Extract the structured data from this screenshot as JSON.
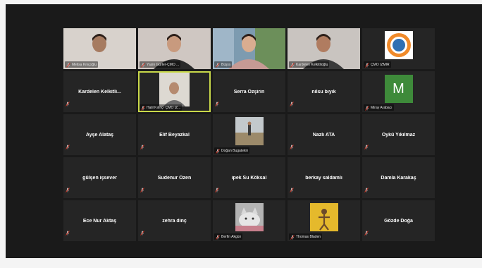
{
  "participants": [
    {
      "label": "Melisa Kılıçoğlu",
      "type": "video"
    },
    {
      "label": "Yasin Gürler-ÇMO ...",
      "type": "video"
    },
    {
      "label": "Büşra",
      "type": "video"
    },
    {
      "label": "Kardelen Kelkitlioğlu",
      "type": "video"
    },
    {
      "label": "ÇMO İZMİR",
      "type": "logo"
    },
    {
      "name": "Kardelen  Kelkitli...",
      "type": "name"
    },
    {
      "label": "Halil Kılınç- ÇMO İZ...",
      "type": "video",
      "active": true
    },
    {
      "name": "Serra Özşirin",
      "type": "name"
    },
    {
      "name": "nilsu bıyık",
      "type": "name"
    },
    {
      "label": "Miray Arabacı",
      "initial": "M",
      "type": "initial"
    },
    {
      "name": "Ayşe Alataş",
      "type": "name"
    },
    {
      "name": "Elif Beyazkal",
      "type": "name"
    },
    {
      "label": "Doğan Bugatekin",
      "type": "photo",
      "photo": "landscape"
    },
    {
      "name": "Nazlı ATA",
      "type": "name"
    },
    {
      "name": "Öykü Yıkılmaz",
      "type": "name"
    },
    {
      "name": "gülşen işsever",
      "type": "name"
    },
    {
      "name": "Sudenur Özen",
      "type": "name"
    },
    {
      "name": "ipek Su Köksal",
      "type": "name"
    },
    {
      "name": "berkay saldamlı",
      "type": "name"
    },
    {
      "name": "Damla Karakaş",
      "type": "name"
    },
    {
      "name": "Ece Nur Aktaş",
      "type": "name"
    },
    {
      "name": "zehra dinç",
      "type": "name"
    },
    {
      "label": "Berfin Akgün",
      "type": "photo",
      "photo": "cat"
    },
    {
      "label": "Thomas Bladen",
      "type": "photo",
      "photo": "yellow"
    },
    {
      "name": "Gözde Doğa",
      "type": "name"
    }
  ],
  "colors": {
    "mic_muted": "#e0301e",
    "active_border": "#c9d94a",
    "tile_bg": "#252525",
    "initial_bg": "#3e8a3a"
  }
}
